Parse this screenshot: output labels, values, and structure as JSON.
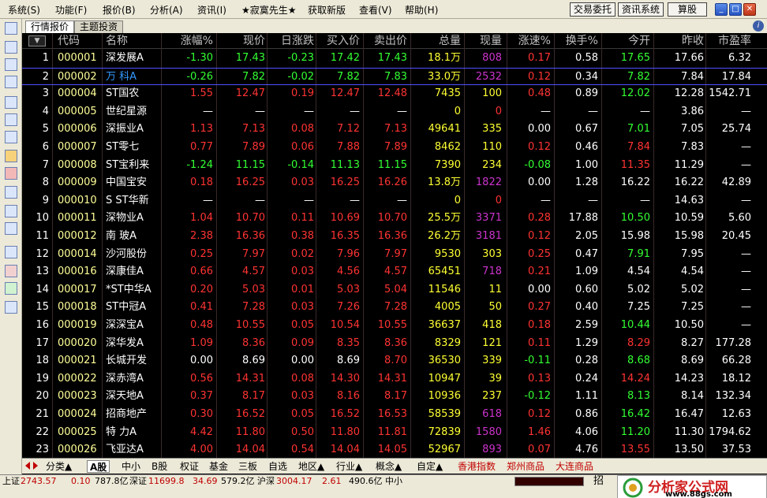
{
  "menu": [
    "系统(S)",
    "功能(F)",
    "报价(B)",
    "分析(A)",
    "资讯(I)",
    "★寂寞先生★",
    "获取新版",
    "查看(V)",
    "帮助(H)"
  ],
  "toolbar_buttons": [
    "交易委托",
    "资讯系统",
    "算股"
  ],
  "panel_tabs": [
    "行情报价",
    "主题投资"
  ],
  "headers": [
    "代码",
    "名称",
    "涨幅%",
    "现价",
    "日涨跌",
    "买入价",
    "卖出价",
    "总量",
    "现量",
    "涨速%",
    "换手%",
    "今开",
    "昨收",
    "市盈率"
  ],
  "rows": [
    [
      "1",
      "000001",
      "深发展A",
      "-1.30",
      "17.43",
      "-0.23",
      "17.42",
      "17.43",
      "18.1万",
      "808",
      "0.17",
      "0.58",
      "17.65",
      "17.66",
      "6.32"
    ],
    [
      "2",
      "000002",
      "万  科A",
      "-0.26",
      "7.82",
      "-0.02",
      "7.82",
      "7.83",
      "33.0万",
      "2532",
      "0.12",
      "0.34",
      "7.82",
      "7.84",
      "17.84"
    ],
    [
      "3",
      "000004",
      "ST国农",
      "1.55",
      "12.47",
      "0.19",
      "12.47",
      "12.48",
      "7435",
      "100",
      "0.48",
      "0.89",
      "12.02",
      "12.28",
      "1542.71"
    ],
    [
      "4",
      "000005",
      "世纪星源",
      "—",
      "—",
      "—",
      "—",
      "—",
      "0",
      "0",
      "—",
      "—",
      "—",
      "3.86",
      "—"
    ],
    [
      "5",
      "000006",
      "深振业A",
      "1.13",
      "7.13",
      "0.08",
      "7.12",
      "7.13",
      "49641",
      "335",
      "0.00",
      "0.67",
      "7.01",
      "7.05",
      "25.74"
    ],
    [
      "6",
      "000007",
      "ST零七",
      "0.77",
      "7.89",
      "0.06",
      "7.88",
      "7.89",
      "8462",
      "110",
      "0.12",
      "0.46",
      "7.84",
      "7.83",
      "—"
    ],
    [
      "7",
      "000008",
      "ST宝利来",
      "-1.24",
      "11.15",
      "-0.14",
      "11.13",
      "11.15",
      "7390",
      "234",
      "-0.08",
      "1.00",
      "11.35",
      "11.29",
      "—"
    ],
    [
      "8",
      "000009",
      "中国宝安",
      "0.18",
      "16.25",
      "0.03",
      "16.25",
      "16.26",
      "13.8万",
      "1822",
      "0.00",
      "1.28",
      "16.22",
      "16.22",
      "42.89"
    ],
    [
      "9",
      "000010",
      "S ST华新",
      "—",
      "—",
      "—",
      "—",
      "—",
      "0",
      "0",
      "—",
      "—",
      "—",
      "14.63",
      "—"
    ],
    [
      "10",
      "000011",
      "深物业A",
      "1.04",
      "10.70",
      "0.11",
      "10.69",
      "10.70",
      "25.5万",
      "3371",
      "0.28",
      "17.88",
      "10.50",
      "10.59",
      "5.60"
    ],
    [
      "11",
      "000012",
      "南  玻A",
      "2.38",
      "16.36",
      "0.38",
      "16.35",
      "16.36",
      "26.2万",
      "3181",
      "0.12",
      "2.05",
      "15.98",
      "15.98",
      "20.45"
    ],
    [
      "12",
      "000014",
      "沙河股份",
      "0.25",
      "7.97",
      "0.02",
      "7.96",
      "7.97",
      "9530",
      "303",
      "0.25",
      "0.47",
      "7.91",
      "7.95",
      "—"
    ],
    [
      "13",
      "000016",
      "深康佳A",
      "0.66",
      "4.57",
      "0.03",
      "4.56",
      "4.57",
      "65451",
      "718",
      "0.21",
      "1.09",
      "4.54",
      "4.54",
      "—"
    ],
    [
      "14",
      "000017",
      "*ST中华A",
      "0.20",
      "5.03",
      "0.01",
      "5.03",
      "5.04",
      "11546",
      "11",
      "0.00",
      "0.60",
      "5.02",
      "5.02",
      "—"
    ],
    [
      "15",
      "000018",
      "ST中冠A",
      "0.41",
      "7.28",
      "0.03",
      "7.26",
      "7.28",
      "4005",
      "50",
      "0.27",
      "0.40",
      "7.25",
      "7.25",
      "—"
    ],
    [
      "16",
      "000019",
      "深深宝A",
      "0.48",
      "10.55",
      "0.05",
      "10.54",
      "10.55",
      "36637",
      "418",
      "0.18",
      "2.59",
      "10.44",
      "10.50",
      "—"
    ],
    [
      "17",
      "000020",
      "深华发A",
      "1.09",
      "8.36",
      "0.09",
      "8.35",
      "8.36",
      "8329",
      "121",
      "0.11",
      "1.29",
      "8.29",
      "8.27",
      "177.28"
    ],
    [
      "18",
      "000021",
      "长城开发",
      "0.00",
      "8.69",
      "0.00",
      "8.69",
      "8.70",
      "36530",
      "339",
      "-0.11",
      "0.28",
      "8.68",
      "8.69",
      "66.28"
    ],
    [
      "19",
      "000022",
      "深赤湾A",
      "0.56",
      "14.31",
      "0.08",
      "14.30",
      "14.31",
      "10947",
      "39",
      "0.13",
      "0.24",
      "14.24",
      "14.23",
      "18.12"
    ],
    [
      "20",
      "000023",
      "深天地A",
      "0.37",
      "8.17",
      "0.03",
      "8.16",
      "8.17",
      "10936",
      "237",
      "-0.12",
      "1.11",
      "8.13",
      "8.14",
      "132.34"
    ],
    [
      "21",
      "000024",
      "招商地产",
      "0.30",
      "16.52",
      "0.05",
      "16.52",
      "16.53",
      "58539",
      "618",
      "0.12",
      "0.86",
      "16.42",
      "16.47",
      "12.63"
    ],
    [
      "22",
      "000025",
      "特  力A",
      "4.42",
      "11.80",
      "0.50",
      "11.80",
      "11.81",
      "72839",
      "1580",
      "1.46",
      "4.06",
      "11.20",
      "11.30",
      "1794.62"
    ],
    [
      "23",
      "000026",
      "飞亚达A",
      "4.00",
      "14.04",
      "0.54",
      "14.04",
      "14.05",
      "52967",
      "893",
      "0.07",
      "4.76",
      "13.55",
      "13.50",
      "37.53"
    ]
  ],
  "bottom_tabs": [
    "分类▲",
    "A股",
    "中小",
    "B股",
    "权证",
    "基金",
    "三板",
    "自选",
    "地区▲",
    "行业▲",
    "概念▲",
    "自定▲",
    "香港指数",
    "郑州商品",
    "大连商品"
  ],
  "status": {
    "sh_label": "上证",
    "sh_val": "2743.57",
    "sh_chg": "0.10",
    "sh_amt": "787.8亿",
    "sz_label": "深证",
    "sz_val": "11699.8",
    "sz_chg": "34.69",
    "sz_amt": "579.2亿",
    "hs_label": "沪深",
    "hs_val": "3004.17",
    "hs_chg": "2.61",
    "hs_amt": "490.6亿",
    "zx_label": "中小",
    "extra": "招"
  },
  "logo": {
    "cn": "分析家公式网",
    "url": "www.88gs.com"
  },
  "colors": {
    "up": "#ff3333",
    "down": "#33ff33",
    "flat": "#ffffff",
    "volume": "#ffff33",
    "code": "#ffff99",
    "name": "#ffffff",
    "purple": "#cc33cc",
    "blue_name": "#3399ff"
  }
}
